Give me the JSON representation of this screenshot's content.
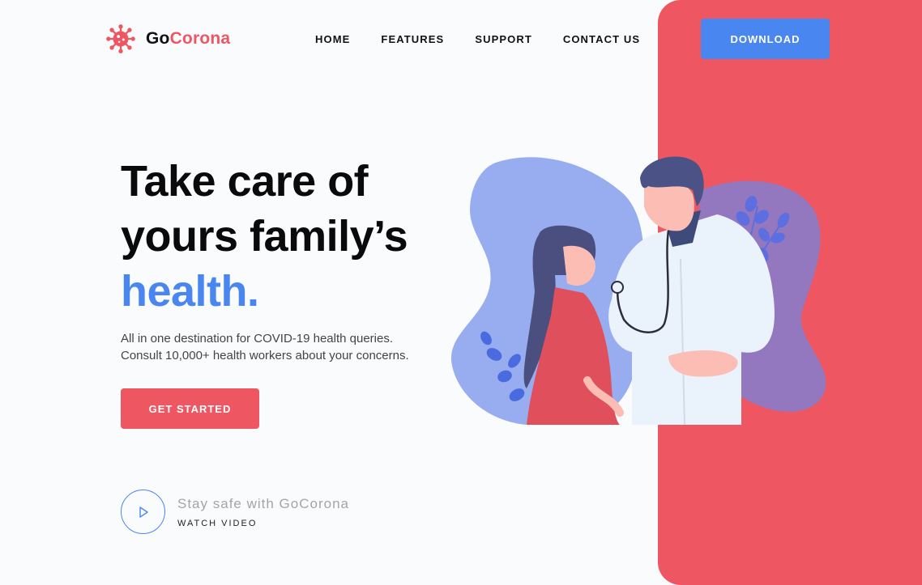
{
  "brand": {
    "name_part1": "Go",
    "name_part2": "Corona",
    "logo_icon": "virus-icon",
    "color_primary": "#ee5762",
    "color_accent": "#4a86f0"
  },
  "nav": {
    "items": [
      {
        "label": "HOME"
      },
      {
        "label": "FEATURES"
      },
      {
        "label": "SUPPORT"
      },
      {
        "label": "CONTACT US"
      }
    ],
    "download_label": "DOWNLOAD"
  },
  "hero": {
    "title_line1": "Take care of",
    "title_line2": "yours family’s",
    "title_accent": "health.",
    "subtitle_line1": "All in one destination for COVID-19 health queries.",
    "subtitle_line2": "Consult 10,000+ health workers about your concerns.",
    "cta_label": "GET STARTED"
  },
  "video": {
    "icon": "play-icon",
    "title": "Stay safe with GoCorona",
    "link_label": "WATCH VIDEO"
  },
  "illustration": {
    "subject": "doctor-and-child-illustration"
  }
}
